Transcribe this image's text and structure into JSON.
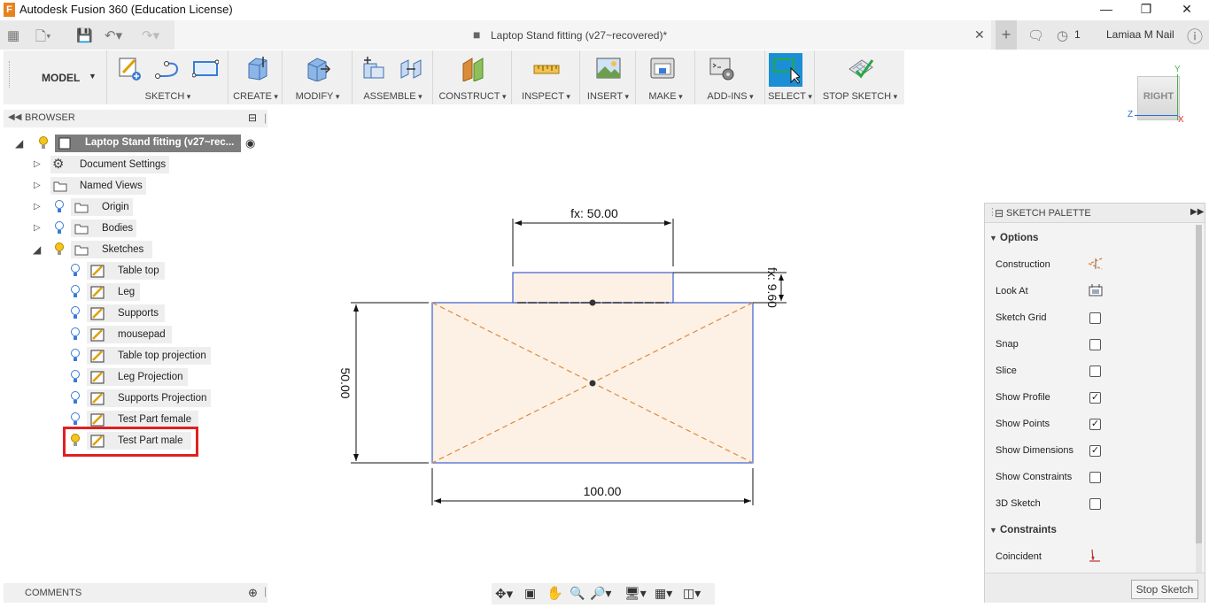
{
  "window": {
    "title": "Autodesk Fusion 360 (Education License)",
    "app_icon_letter": "F"
  },
  "tabbar": {
    "doc_title": "Laptop Stand fitting (v27~recovered)*",
    "job_count": "1",
    "user": "Lamiaa M Nail"
  },
  "toolbar": {
    "workspace": "MODEL",
    "groups": [
      "SKETCH",
      "CREATE",
      "MODIFY",
      "ASSEMBLE",
      "CONSTRUCT",
      "INSPECT",
      "INSERT",
      "MAKE",
      "ADD-INS",
      "SELECT",
      "STOP SKETCH"
    ]
  },
  "viewcube": {
    "face": "RIGHT",
    "axis_y": "Y",
    "axis_z": "Z",
    "axis_x": "X"
  },
  "browser": {
    "header": "BROWSER",
    "root": "Laptop Stand fitting (v27~rec...",
    "items": {
      "document_settings": "Document Settings",
      "named_views": "Named Views",
      "origin": "Origin",
      "bodies": "Bodies",
      "sketches": "Sketches"
    },
    "sketches": [
      "Table top",
      "Leg",
      "Supports",
      "mousepad",
      "Table top projection",
      "Leg Projection",
      "Supports Projection",
      "Test Part female",
      "Test Part male"
    ]
  },
  "canvas": {
    "dim_top_width": "fx: 50.00",
    "dim_tab_height": "fx: 9.60",
    "dim_height": "50.00",
    "dim_width": "100.00"
  },
  "palette": {
    "title": "SKETCH PALETTE",
    "options_header": "Options",
    "rows": [
      {
        "label": "Construction",
        "type": "icon"
      },
      {
        "label": "Look At",
        "type": "icon"
      },
      {
        "label": "Sketch Grid",
        "checked": false
      },
      {
        "label": "Snap",
        "checked": false
      },
      {
        "label": "Slice",
        "checked": false
      },
      {
        "label": "Show Profile",
        "checked": true
      },
      {
        "label": "Show Points",
        "checked": true
      },
      {
        "label": "Show Dimensions",
        "checked": true
      },
      {
        "label": "Show Constraints",
        "checked": false
      },
      {
        "label": "3D Sketch",
        "checked": false
      }
    ],
    "constraints_header": "Constraints",
    "constraint_first": "Coincident",
    "stop_button": "Stop Sketch"
  },
  "comments": {
    "label": "COMMENTS"
  },
  "colors": {
    "select_active": "#1a8fd6",
    "sketch_fill": "#fdf1e6",
    "sketch_line": "#3a5fcd",
    "construction_line": "#e08a3c",
    "highlight_box": "#e02020"
  }
}
